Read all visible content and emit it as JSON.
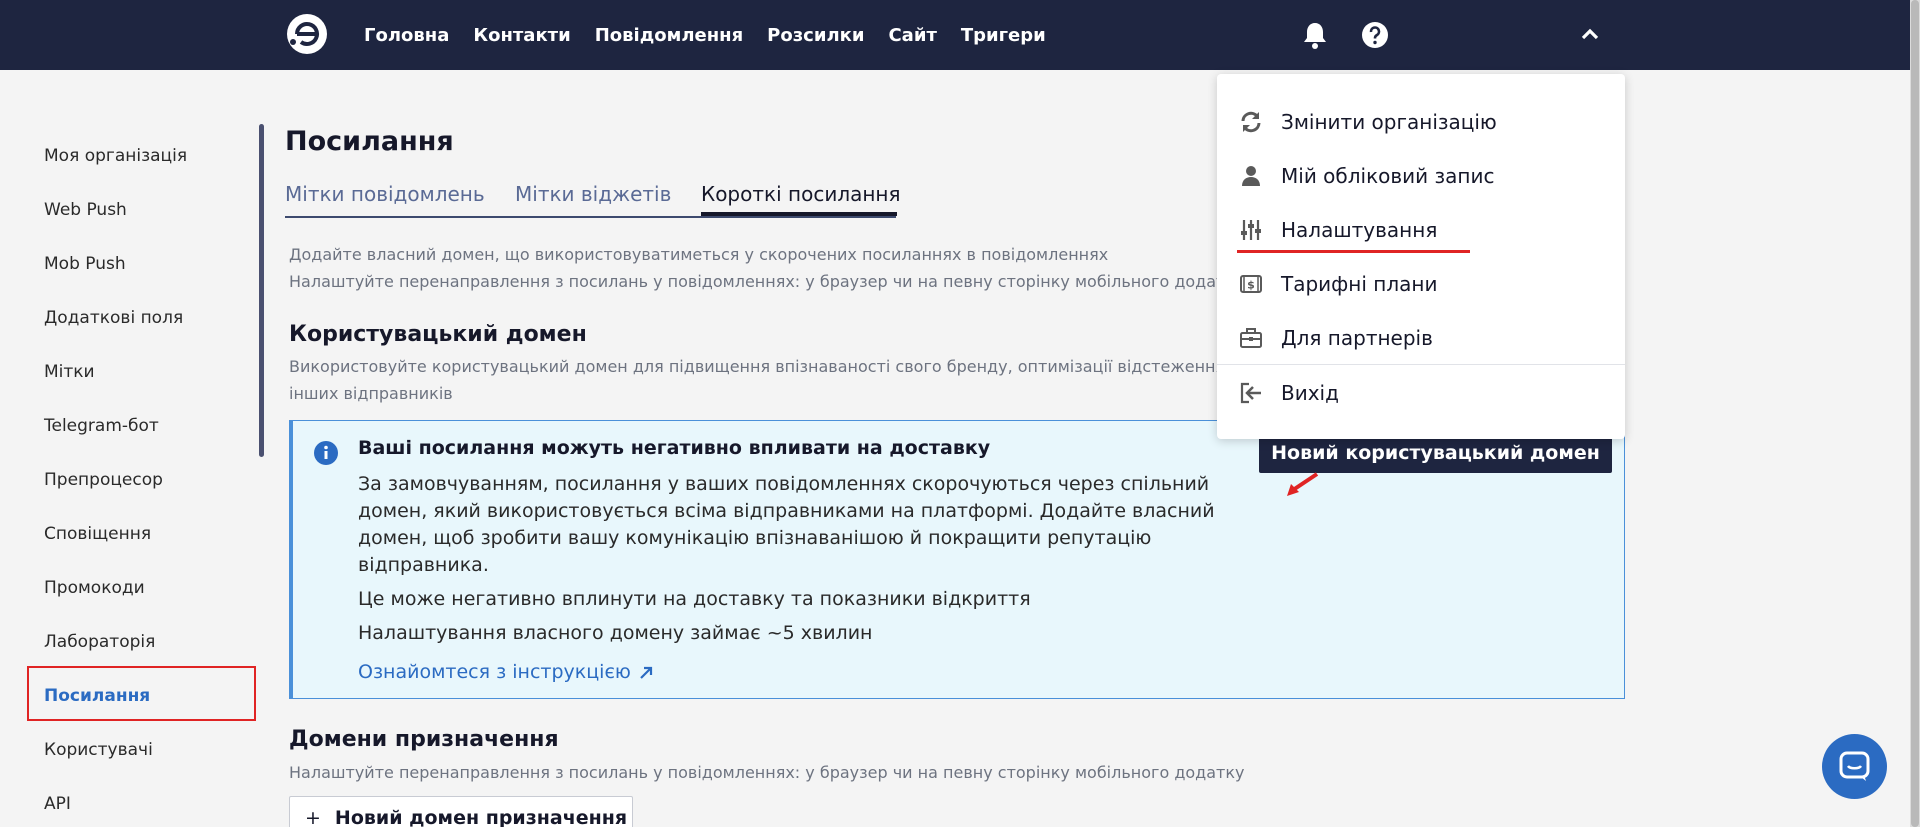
{
  "nav": {
    "items": [
      "Головна",
      "Контакти",
      "Повідомлення",
      "Розсилки",
      "Сайт",
      "Тригери"
    ],
    "logo_icon": "esputnik-logo-icon",
    "bell_icon": "bell-icon",
    "help_icon": "question-circle-icon",
    "menu_toggle_icon": "chevron-up-icon"
  },
  "sidebar": {
    "items": [
      {
        "label": "Моя організація"
      },
      {
        "label": "Web Push"
      },
      {
        "label": "Mob Push"
      },
      {
        "label": "Додаткові поля"
      },
      {
        "label": "Мітки"
      },
      {
        "label": "Telegram-бот"
      },
      {
        "label": "Препроцесор"
      },
      {
        "label": "Сповіщення"
      },
      {
        "label": "Промокоди"
      },
      {
        "label": "Лабораторія"
      },
      {
        "label": "Посилання",
        "active": true
      },
      {
        "label": "Користувачі"
      },
      {
        "label": "API"
      }
    ]
  },
  "page": {
    "title": "Посилання",
    "tabs": [
      {
        "label": "Мітки повідомлень"
      },
      {
        "label": "Мітки віджетів"
      },
      {
        "label": "Короткі посилання",
        "active": true
      }
    ],
    "description_line1": "Додайте власний домен, що використовуватиметься у скорочених посиланнях в повідомленнях",
    "description_line2": "Налаштуйте перенаправлення з посилань у повідомленнях: у браузер чи на певну сторінку мобільного додатку",
    "custom_domain": {
      "heading": "Користувацький домен",
      "description_line1": "Використовуйте користувацький домен для підвищення впізнаваності свого бренду, оптимізації відстеження пе",
      "description_line2": "інших відправників",
      "new_button": "Новий користувацький домен"
    },
    "alert": {
      "icon": "info-circle-icon",
      "title": "Ваші посилання можуть негативно впливати на доставку",
      "paragraph_lines": [
        "За замовчуванням, посилання у ваших повідомленнях скорочуються через спільний",
        "домен, який використовується всіма відправниками на платформі. Додайте власний",
        "домен, щоб зробити вашу комунікацію впізнаванішою й покращити репутацію",
        "відправника."
      ],
      "line2": "Це може негативно вплинути на доставку та показники відкриття",
      "line3": "Налаштування власного домену займає ~5 хвилин",
      "link": "Ознайомтеся з інструкцією",
      "link_icon": "external-link-arrow-icon"
    },
    "destination_domains": {
      "heading": "Домени призначення",
      "description": "Налаштуйте перенаправлення з посилань у повідомленнях: у браузер чи на певну сторінку мобільного додатку",
      "new_button": "Новий домен призначення",
      "plus": "+"
    }
  },
  "dropdown": {
    "items": [
      {
        "label": "Змінити організацію",
        "icon": "sync-icon"
      },
      {
        "label": "Мій обліковий запис",
        "icon": "user-icon"
      },
      {
        "label": "Налаштування",
        "icon": "sliders-icon"
      },
      {
        "label": "Тарифні плани",
        "icon": "money-bill-icon"
      },
      {
        "label": "Для партнерів",
        "icon": "briefcase-icon"
      },
      {
        "label": "Вихід",
        "icon": "sign-out-icon"
      }
    ]
  },
  "chat": {
    "icon": "chat-icon"
  },
  "colors": {
    "topbar": "#1e2540",
    "accent": "#2b6bc2",
    "highlight": "#e02424",
    "alert_bg": "#e8f7fc"
  }
}
